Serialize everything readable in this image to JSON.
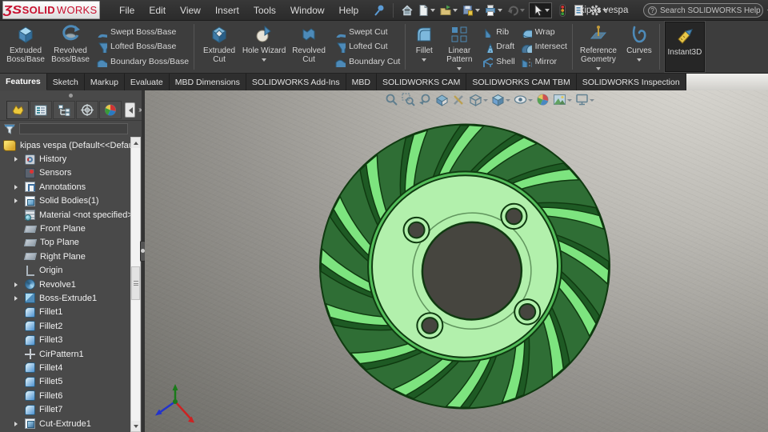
{
  "colors": {
    "titlebar_bg": "#2e2e2e",
    "ribbon_bg": "#3d3d3d",
    "panel_bg": "#494949",
    "logo_red": "#c8102e",
    "icon_blue": "#4d8ab8",
    "viewport_top": "#d8d6d0",
    "viewport_bottom": "#6e6d68",
    "fan_backplate": "#2f6e35",
    "fan_blade": "#7de47f",
    "fan_blade_dark": "#1e5a24",
    "fan_cone": "#54bd5a",
    "fan_flange": "#b2f0ac",
    "fan_outline": "#0f3a10",
    "fan_hole": "#46453f",
    "triad_x": "#cc2222",
    "triad_y": "#1a7a1a",
    "triad_z": "#2233cc"
  },
  "titlebar": {
    "logo_ds": "ƷS",
    "logo_solid": "SOLID",
    "logo_works": "WORKS",
    "menus": [
      "File",
      "Edit",
      "View",
      "Insert",
      "Tools",
      "Window",
      "Help"
    ],
    "document_title": "kipas vespa",
    "search_help_icon": "?",
    "search_placeholder": "Search SOLIDWORKS Help"
  },
  "ribbon": {
    "extruded_boss": "Extruded Boss/Base",
    "revolved_boss": "Revolved Boss/Base",
    "swept_boss": "Swept Boss/Base",
    "lofted_boss": "Lofted Boss/Base",
    "boundary_boss": "Boundary Boss/Base",
    "extruded_cut": "Extruded Cut",
    "hole_wizard": "Hole Wizard",
    "revolved_cut": "Revolved Cut",
    "swept_cut": "Swept Cut",
    "lofted_cut": "Lofted Cut",
    "boundary_cut": "Boundary Cut",
    "fillet": "Fillet",
    "linear_pattern": "Linear Pattern",
    "rib": "Rib",
    "draft": "Draft",
    "shell": "Shell",
    "wrap": "Wrap",
    "intersect": "Intersect",
    "mirror": "Mirror",
    "reference_geometry": "Reference Geometry",
    "curves": "Curves",
    "instant3d": "Instant3D"
  },
  "tabs": {
    "active": "Features",
    "items": [
      "Features",
      "Sketch",
      "Markup",
      "Evaluate",
      "MBD Dimensions",
      "SOLIDWORKS Add-Ins",
      "MBD",
      "SOLIDWORKS CAM",
      "SOLIDWORKS CAM TBM",
      "SOLIDWORKS Inspection"
    ]
  },
  "panel_tabs": [
    "feature-manager",
    "property-manager",
    "configuration-manager",
    "dimxpert-manager",
    "display-manager"
  ],
  "tree": {
    "items": [
      {
        "label": "kipas vespa  (Default<<Default>_D",
        "icon": "part"
      },
      {
        "label": "History",
        "icon": "history",
        "expand": true
      },
      {
        "label": "Sensors",
        "icon": "sensors"
      },
      {
        "label": "Annotations",
        "icon": "annotations",
        "expand": true
      },
      {
        "label": "Solid Bodies(1)",
        "icon": "solid-bodies",
        "expand": true
      },
      {
        "label": "Material <not specified>",
        "icon": "material"
      },
      {
        "label": "Front Plane",
        "icon": "plane"
      },
      {
        "label": "Top Plane",
        "icon": "plane"
      },
      {
        "label": "Right Plane",
        "icon": "plane"
      },
      {
        "label": "Origin",
        "icon": "origin"
      },
      {
        "label": "Revolve1",
        "icon": "revolve",
        "expand": true
      },
      {
        "label": "Boss-Extrude1",
        "icon": "boss-extrude",
        "expand": true
      },
      {
        "label": "Fillet1",
        "icon": "fillet"
      },
      {
        "label": "Fillet2",
        "icon": "fillet"
      },
      {
        "label": "Fillet3",
        "icon": "fillet"
      },
      {
        "label": "CirPattern1",
        "icon": "circular-pattern"
      },
      {
        "label": "Fillet4",
        "icon": "fillet"
      },
      {
        "label": "Fillet5",
        "icon": "fillet"
      },
      {
        "label": "Fillet6",
        "icon": "fillet"
      },
      {
        "label": "Fillet7",
        "icon": "fillet"
      },
      {
        "label": "Cut-Extrude1",
        "icon": "cut-extrude",
        "expand": true
      }
    ]
  },
  "viewport": {
    "headsup_icons": [
      "zoom-to-fit",
      "zoom-to-area",
      "previous-view",
      "section-view",
      "dynamic-annotation-views",
      "view-orientation",
      "display-style",
      "hide-show-items",
      "edit-appearance",
      "apply-scene",
      "view-settings"
    ],
    "fan_blade_count": 16
  }
}
